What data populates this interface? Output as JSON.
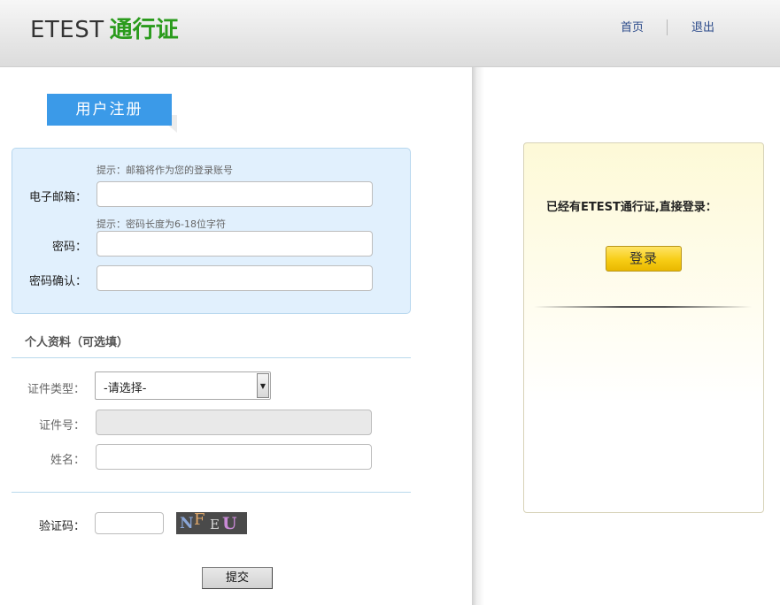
{
  "header": {
    "logo_text": "ETEST",
    "logo_accent": "通行证",
    "nav_home": "首页",
    "nav_logout": "退出"
  },
  "register": {
    "tab_label": "用户注册",
    "email_hint": "提示：邮箱将作为您的登录账号",
    "email_label": "电子邮箱：",
    "email_value": "",
    "password_hint": "提示：密码长度为6-18位字符",
    "password_label": "密码：",
    "confirm_label": "密码确认："
  },
  "profile": {
    "section_title": "个人资料（可选填）",
    "id_type_label": "证件类型：",
    "id_type_selected": "-请选择-",
    "id_number_label": "证件号：",
    "name_label": "姓名："
  },
  "captcha": {
    "label": "验证码：",
    "chars": [
      "N",
      "F",
      "E",
      "U"
    ]
  },
  "submit_label": "提交",
  "login_panel": {
    "text": "已经有ETEST通行证,直接登录：",
    "button": "登录"
  },
  "colors": {
    "accent_green": "#2a9b1c",
    "tab_blue": "#3b9ae8",
    "login_yellow": "#f7cd15"
  }
}
